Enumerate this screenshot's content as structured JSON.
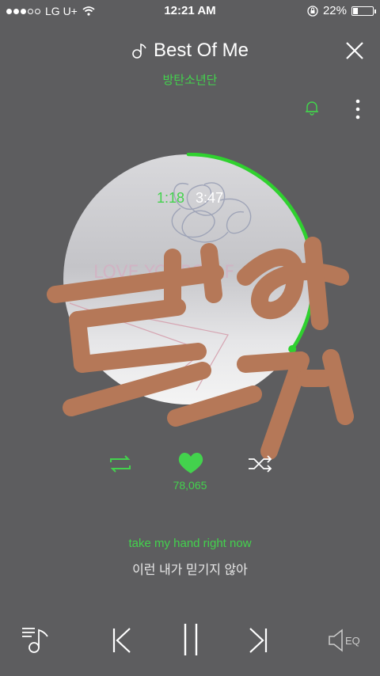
{
  "status_bar": {
    "carrier": "LG U+",
    "time": "12:21 AM",
    "battery": "22%"
  },
  "song": {
    "title": "Best Of Me",
    "artist": "방탄소년단"
  },
  "playback": {
    "current_time": "1:18",
    "total_time": "3:47",
    "progress_fraction": 0.344
  },
  "likes": {
    "count": "78,065"
  },
  "lyrics": {
    "line_en": "take my hand right now",
    "line_ko": "이런 내가 믿기지 않아"
  },
  "bottom_bar": {
    "eq_label": "EQ"
  },
  "colors": {
    "accent": "#43d24d",
    "background": "#5d5d5f",
    "scribble": "#b57858"
  }
}
